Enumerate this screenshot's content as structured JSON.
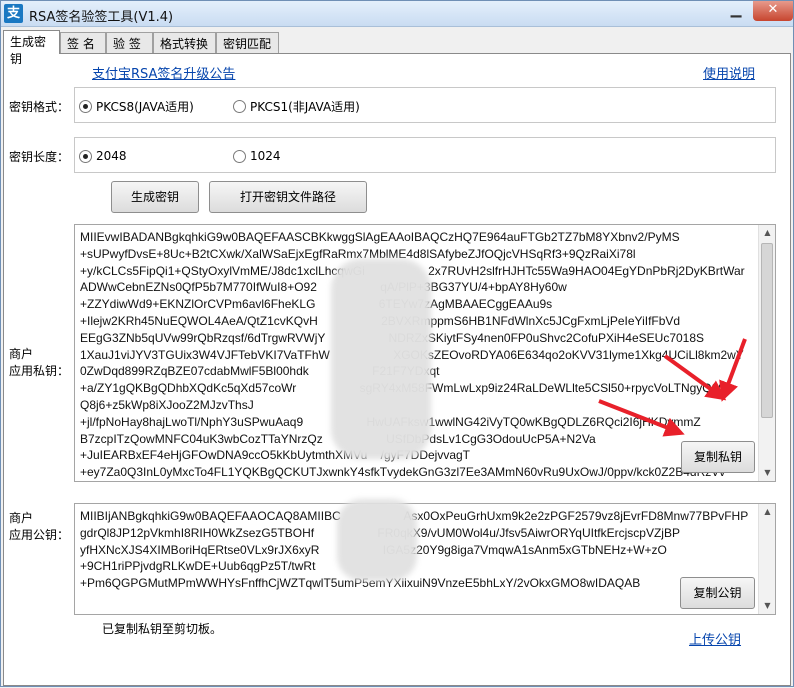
{
  "window": {
    "icon": "支",
    "title": "RSA签名验签工具(V1.4)"
  },
  "tabs": [
    "生成密钥",
    "签 名",
    "验 签",
    "格式转换",
    "密钥匹配"
  ],
  "links": {
    "announcement": "支付宝RSA签名升级公告",
    "help": "使用说明",
    "upload": "上传公钥"
  },
  "key_format": {
    "label": "密钥格式：",
    "options": [
      "PKCS8(JAVA适用)",
      "PKCS1(非JAVA适用)"
    ],
    "selected": "PKCS8(JAVA适用)"
  },
  "key_length": {
    "label": "密钥长度：",
    "options": [
      "2048",
      "1024"
    ],
    "selected": "2048"
  },
  "buttons": {
    "generate": "生成密钥",
    "open_path": "打开密钥文件路径",
    "copy_private": "复制私钥",
    "copy_public": "复制公钥"
  },
  "private_key": {
    "label_line1": "商户",
    "label_line2": "应用私钥：",
    "lines": [
      "MIIEvwIBADANBgkqhkiG9w0BAQEFAASCBKkwggSlAgEAAoIBAQCzHQ7E964auFTGb2TZ7bM8YXbnv2/PyMS",
      "+sUPwyfDvsE+8Uc+B2tCXwk/XalWSaEjxEgfRaRmx7MblME4d8lSAfybeZJfOQjcVHSqRf3+9QzRaiXi78l",
      "+y/kCLCs5FipQi1+QStyOxylVmME/J8dc1xclLhcqwGi                   2x7RUvH2slfrHJHTc55Wa9HAO04EgYDnPbRj2DyKBrtWar",
      "ADWwCebnEZNs0QfP5b7M770IfWuI8+O92                   qA/PlP+3BG37YU/4+bpAY8Hy60w",
      "+ZZYdiwWd9+EKNZlOrCVPm6avl6FheKLG                   6TEYw7zAgMBAAECggEAAu9s",
      "+Ilejw2KRh45NuEQWOL4AeA/QtZ1cvKQvH                   2BVXRmppmS6HB1NFdWlnXc5JCgFxmLjPeIeYiIfFbVd",
      "EEgG3ZNb5qUVw99rQbRzqsf/6dTrgwRVWjY                   NDRZxSKiytFSy4nen0FP0uShvc2CofuPXiH4eSEUc7018S",
      "1XauJ1viJYV3TGUix3W4VJFTebVKI7VaTFhW                   XGOKsZEOvoRDYA06E634qo2oKVV31lyme1Xkg4UCiLl8km2wY",
      "0ZwDqd899RZqBZE07cdabMwlF5Bl00hdk                   F21F7YDxqt",
      "+a/ZY1gQKBgQDhbXQdKc5qXd57coWr                   sgRY4xM58FWmLwLxp9iz24RaLDeWLlte5CSl50+rpycVoLTNgyQ00p",
      "Q8j6+z5kWp8iXJooZ2MJzvThsJ",
      "+jl/fpNoHay8hajLwoTl/NphY3uSPwuAaq9                   HwUAFksw1wwlNG42iVyTQ0wKBgQDLZ6RQci2I6jHKDymmZ",
      "B7zcpITzQowMNFC04uK3wbCozTTaYNrzQz                   USfDbPdsLv1CgG3OdouUcP5A+N2Va",
      "+JuIEARBxEF4eHjGFOwDNA9ccO5kKbUytmthXMVu    /gyF7DDejvvagT",
      "+ey7Za0Q3InL0yMxcTo4FL1YQKBgQCKUTJxwnkY4sfkTvydekGnG3zl7Ee3AMmN60vRu9UxOwJ/0ppv/kck0Z2B4dRzVv"
    ]
  },
  "public_key": {
    "label_line1": "商户",
    "label_line2": "应用公钥：",
    "lines": [
      "MIIBIjANBgkqhkiG9w0BAQEFAAOCAQ8AMIIBC                   Asx0OxPeuGrhUxm9k2e2zPGF2579vz8jEvrFD8Mnw77BPvFHP",
      "gdrQl8JP12pVkmhI8RIH0WkZsezG5TBOHf                   FR0qkX9/vUM0Wol4u/Jfsv5AiwrORYqUItfkErcjscpVZjBP",
      "yfHXNcXJS4XIMBoriHqERtse0VLx9rJX6xyR                   IGA5z20Y9g8iga7VmqwA1sAnm5xGTbNEHz+W+zO",
      "+9CH1riPPjvdgRLKwDE+Uub6qgPz5T/twRt",
      "+Pm6QGPGMutMPmWWHYsFnffhCjWZTqwlT5umP5emYXiixuiN9VnzeE5bhLxY/2vOkxGMO8wIDAQAB"
    ]
  },
  "status": "已复制私钥至剪切板。"
}
